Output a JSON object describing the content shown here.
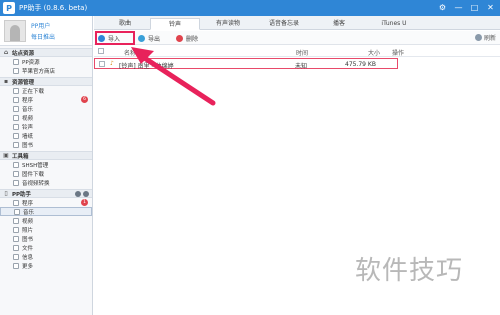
{
  "app": {
    "title": "PP助手 (0.8.6. beta)",
    "logo": "P"
  },
  "window_controls": [
    "⚙",
    "—",
    "□",
    "✕"
  ],
  "user": {
    "name": "PP用户",
    "action": "每日推出"
  },
  "sidebar": {
    "sections": [
      {
        "title": "站点资源",
        "icon": "home-icon",
        "items": [
          {
            "label": "PP资源"
          },
          {
            "label": "苹果官方商店"
          }
        ]
      },
      {
        "title": "资源管理",
        "icon": "folder-icon",
        "items": [
          {
            "label": "正在下载"
          },
          {
            "label": "程序",
            "badge": "6"
          },
          {
            "label": "音乐"
          },
          {
            "label": "视频"
          },
          {
            "label": "铃声"
          },
          {
            "label": "墙纸"
          },
          {
            "label": "图书"
          }
        ]
      },
      {
        "title": "工具箱",
        "icon": "toolbox-icon",
        "items": [
          {
            "label": "SHSH管理"
          },
          {
            "label": "固件下载"
          },
          {
            "label": "音视频转换"
          }
        ]
      },
      {
        "title": "PP助手",
        "icon": "device-icon",
        "items": [
          {
            "label": "程序",
            "badge": "1"
          },
          {
            "label": "音乐",
            "selected": true
          },
          {
            "label": "视频"
          },
          {
            "label": "照片"
          },
          {
            "label": "图书"
          },
          {
            "label": "文件"
          },
          {
            "label": "信息"
          },
          {
            "label": "更多"
          }
        ]
      }
    ]
  },
  "tabs": [
    "歌曲",
    "铃声",
    "有声读物",
    "语音备忘录",
    "播客",
    "iTunes U"
  ],
  "active_tab": 1,
  "toolbar": {
    "import": "导入",
    "export": "导出",
    "delete": "删除",
    "refresh": "刷新"
  },
  "table": {
    "headers": {
      "name": "名称",
      "time": "时间",
      "size": "大小",
      "action": "操作"
    },
    "rows": [
      {
        "name": "[铃声] 南里 - 曲绵婷",
        "time": "未知",
        "size": "475.79 KB"
      }
    ]
  },
  "watermark": "软件技巧",
  "colors": {
    "titlebar": "#2f86d6",
    "highlight": "#e8225b"
  }
}
